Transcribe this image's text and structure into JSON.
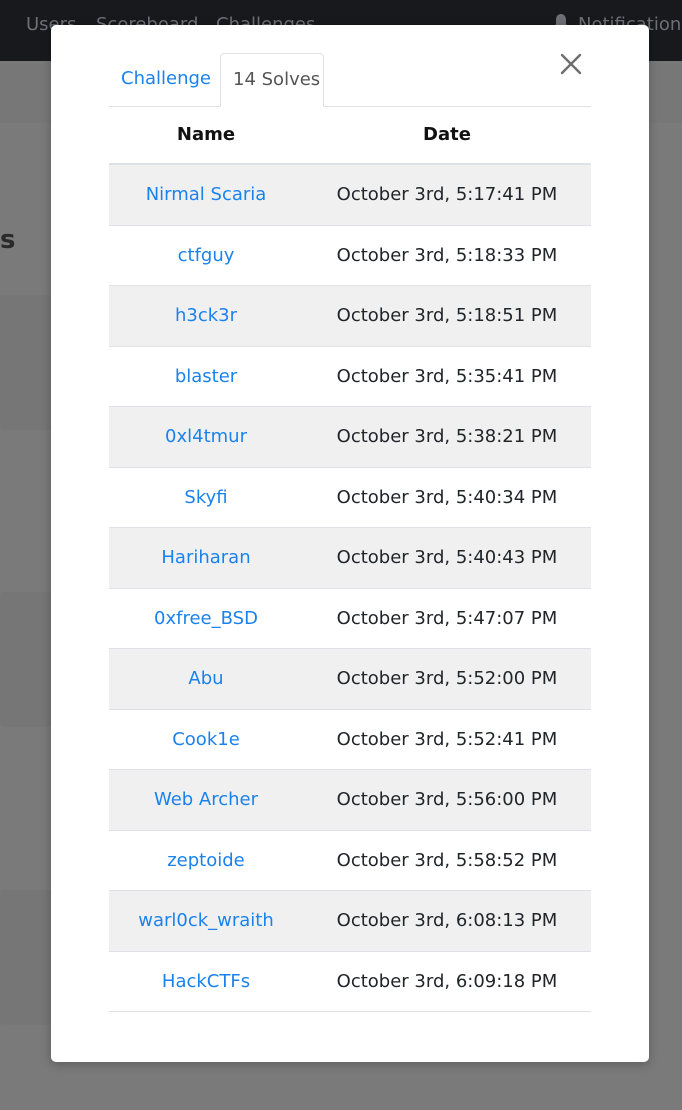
{
  "navbar": {
    "links": [
      "Users",
      "Scoreboard",
      "Challenges"
    ],
    "notifications_label": "Notifications"
  },
  "background": {
    "heading_fragment": "s"
  },
  "modal": {
    "tabs": [
      {
        "label": "Challenge",
        "active": false
      },
      {
        "label": "14 Solves",
        "active": true
      }
    ],
    "table": {
      "headers": [
        "Name",
        "Date"
      ],
      "rows": [
        {
          "name": "Nirmal Scaria",
          "date": "October 3rd, 5:17:41 PM"
        },
        {
          "name": "ctfguy",
          "date": "October 3rd, 5:18:33 PM"
        },
        {
          "name": "h3ck3r",
          "date": "October 3rd, 5:18:51 PM"
        },
        {
          "name": "blaster",
          "date": "October 3rd, 5:35:41 PM"
        },
        {
          "name": "0xl4tmur",
          "date": "October 3rd, 5:38:21 PM"
        },
        {
          "name": "Skyfi",
          "date": "October 3rd, 5:40:34 PM"
        },
        {
          "name": "Hariharan",
          "date": "October 3rd, 5:40:43 PM"
        },
        {
          "name": "0xfree_BSD",
          "date": "October 3rd, 5:47:07 PM"
        },
        {
          "name": "Abu",
          "date": "October 3rd, 5:52:00 PM"
        },
        {
          "name": "Cook1e",
          "date": "October 3rd, 5:52:41 PM"
        },
        {
          "name": "Web Archer",
          "date": "October 3rd, 5:56:00 PM"
        },
        {
          "name": "zeptoide",
          "date": "October 3rd, 5:58:52 PM"
        },
        {
          "name": "warl0ck_wraith",
          "date": "October 3rd, 6:08:13 PM"
        },
        {
          "name": "HackCTFs",
          "date": "October 3rd, 6:09:18 PM"
        }
      ]
    }
  },
  "colors": {
    "link": "#1a82ed",
    "navbar": "#18191c",
    "stripe": "#f0f0f0"
  }
}
